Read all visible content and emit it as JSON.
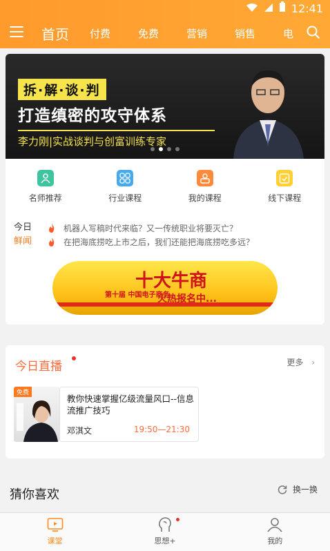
{
  "status": {
    "time": "12:41"
  },
  "nav": {
    "tabs": [
      {
        "label": "首页",
        "active": true
      },
      {
        "label": "付费"
      },
      {
        "label": "免费"
      },
      {
        "label": "营销"
      },
      {
        "label": "销售"
      },
      {
        "label": "电"
      }
    ]
  },
  "banner": {
    "tag": "拆·解·谈·判",
    "headline": "打造缜密的攻守体系",
    "subline": "李力刚|实战谈判与创富训练专家"
  },
  "quick": [
    {
      "label": "名师推荐",
      "color": "#3ec5a0"
    },
    {
      "label": "行业课程",
      "color": "#47a9ee"
    },
    {
      "label": "我的课程",
      "color": "#ff8a3c"
    },
    {
      "label": "线下课程",
      "color": "#ffcf33"
    }
  ],
  "news": {
    "label_line1": "今日",
    "label_line2": "鲜闻",
    "items": [
      "机器人写稿时代来临？又一传统职业将要灭亡？",
      "在把海底捞吃上市之后，我们还能把海底捞吃多远？"
    ]
  },
  "ad": {
    "title": "十大牛商",
    "small": "第十届 中国电子商务",
    "cta": "火热报名中..."
  },
  "live": {
    "section_title": "今日直播",
    "more": "更多",
    "item": {
      "badge": "免费",
      "title": "教你快速掌握亿级流量风口--信息流推广技巧",
      "host": "邓淇文",
      "time": "19:50—21:30"
    }
  },
  "guess": {
    "title": "猜你喜欢",
    "refresh": "换一换"
  },
  "tabbar": [
    {
      "label": "课堂",
      "active": true
    },
    {
      "label": "思想+"
    },
    {
      "label": "我的"
    }
  ],
  "colors": {
    "accent": "#ff9a2c",
    "live": "#ff6a3a"
  }
}
